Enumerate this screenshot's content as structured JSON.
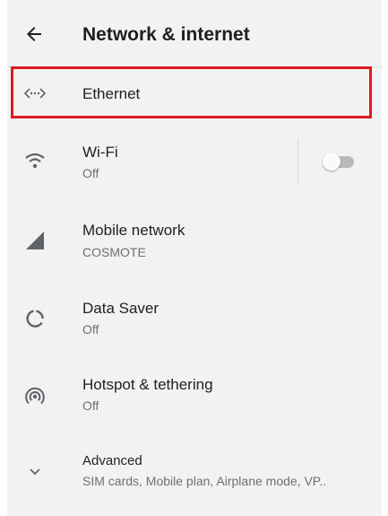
{
  "header": {
    "back_icon": "arrow-back-icon",
    "title": "Network & internet"
  },
  "items": [
    {
      "icon": "ethernet-icon",
      "label": "Ethernet",
      "highlighted": true
    },
    {
      "icon": "wifi-icon",
      "label": "Wi-Fi",
      "status": "Off",
      "toggle_on": false
    },
    {
      "icon": "cellular-signal-icon",
      "label": "Mobile network",
      "status": "COSMOTE"
    },
    {
      "icon": "data-saver-icon",
      "label": "Data Saver",
      "status": "Off"
    },
    {
      "icon": "hotspot-icon",
      "label": "Hotspot & tethering",
      "status": "Off"
    },
    {
      "icon": "chevron-down-icon",
      "label": "Advanced",
      "status": "SIM cards, Mobile plan, Airplane mode, VP.."
    }
  ],
  "colors": {
    "highlight_border": "#e0191f",
    "background": "#f2f2f2",
    "icon": "#5f6368",
    "text_primary": "#202124",
    "text_secondary": "#6f6f6f"
  }
}
